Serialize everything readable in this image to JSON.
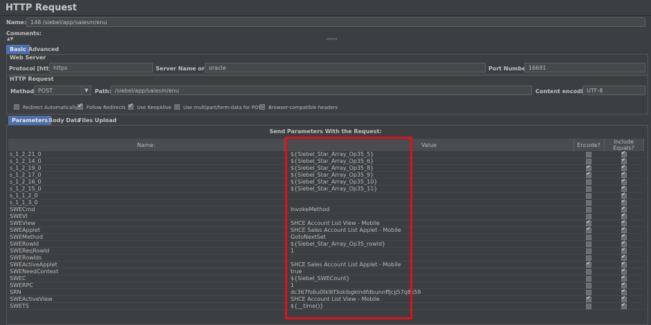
{
  "header": {
    "title": "HTTP Request",
    "name_label": "Name:",
    "name_value": "148 /siebel/app/salesm/enu",
    "comments_label": "Comments:",
    "toggle_arrows": "▲▼",
    "splitter": "ooooo"
  },
  "tabs": {
    "basic": "Basic",
    "advanced": "Advanced"
  },
  "web_server": {
    "title": "Web Server",
    "protocol_label": "Protocol [http]:",
    "protocol_value": "https",
    "server_label": "Server Name or IP:",
    "server_value": "oracle",
    "port_label": "Port Number:",
    "port_value": "16691"
  },
  "http_request": {
    "title": "HTTP Request",
    "method_label": "Method:",
    "method_value": "POST",
    "path_label": "Path:",
    "path_value": "/siebel/app/salesm/enu",
    "encoding_label": "Content encoding:",
    "encoding_value": "UTF-8",
    "options": [
      {
        "label": "Redirect Automatically",
        "checked": false
      },
      {
        "label": "Follow Redirects",
        "checked": true
      },
      {
        "label": "Use KeepAlive",
        "checked": true
      },
      {
        "label": "Use multipart/form-data for POST",
        "checked": false
      },
      {
        "label": "Browser-compatible headers",
        "checked": false
      }
    ]
  },
  "sub_tabs": {
    "parameters": "Parameters",
    "body_data": "Body Data",
    "files_upload": "Files Upload"
  },
  "params": {
    "title": "Send Parameters With the Request:",
    "headers": {
      "name": "Name:",
      "value": "Value",
      "encode": "Encode?",
      "include": "Include Equals?"
    },
    "rows": [
      {
        "name": "s_1_2_21_0",
        "value": "${Siebel_Star_Array_Op35_5}",
        "encode": false,
        "include": true
      },
      {
        "name": "s_1_2_14_0",
        "value": "${Siebel_Star_Array_Op35_6}",
        "encode": false,
        "include": true
      },
      {
        "name": "s_1_2_19_0",
        "value": "${Siebel_Star_Array_Op35_8}",
        "encode": true,
        "include": true
      },
      {
        "name": "s_1_2_17_0",
        "value": "${Siebel_Star_Array_Op35_9}",
        "encode": true,
        "include": true
      },
      {
        "name": "s_1_2_16_0",
        "value": "${Siebel_Star_Array_Op35_10}",
        "encode": false,
        "include": true
      },
      {
        "name": "s_1_2_15_0",
        "value": "${Siebel_Star_Array_Op35_11}",
        "encode": false,
        "include": true
      },
      {
        "name": "s_1_1_2_0",
        "value": "",
        "encode": false,
        "include": true
      },
      {
        "name": "s_1_1_3_0",
        "value": "",
        "encode": false,
        "include": true
      },
      {
        "name": "SWECmd",
        "value": "InvokeMethod",
        "encode": false,
        "include": true
      },
      {
        "name": "SWEVI",
        "value": "",
        "encode": false,
        "include": true
      },
      {
        "name": "SWEView",
        "value": "SHCE Account List View - Mobile",
        "encode": true,
        "include": true
      },
      {
        "name": "SWEApplet",
        "value": "SHCE Sales Account List Applet - Mobile",
        "encode": true,
        "include": true
      },
      {
        "name": "SWEMethod",
        "value": "GotoNextSet",
        "encode": false,
        "include": true
      },
      {
        "name": "SWERowId",
        "value": "${Siebel_Star_Array_Op35_rowId}",
        "encode": false,
        "include": true
      },
      {
        "name": "SWEReqRowId",
        "value": "1",
        "encode": false,
        "include": true
      },
      {
        "name": "SWERowIds",
        "value": "",
        "encode": false,
        "include": true
      },
      {
        "name": "SWEActiveApplet",
        "value": "SHCE Sales Account List Applet - Mobile",
        "encode": true,
        "include": true
      },
      {
        "name": "SWENeedContext",
        "value": "true",
        "encode": false,
        "include": true
      },
      {
        "name": "SWEC",
        "value": "${Siebel_SWECount}",
        "encode": false,
        "include": true
      },
      {
        "name": "SWERPC",
        "value": "1",
        "encode": false,
        "include": true
      },
      {
        "name": "SRN",
        "value": "dc367fs6u0tk9lf3okibgklndfdbunnffjcjj57q8s59",
        "encode": false,
        "include": true
      },
      {
        "name": "SWEActiveView",
        "value": "SHCE Account List View - Mobile",
        "encode": true,
        "include": true
      },
      {
        "name": "SWETS",
        "value": "${__time()}",
        "encode": false,
        "include": true
      }
    ]
  },
  "colors": {
    "background": "#3c3f41",
    "tab_active": "#4b6eaf",
    "highlight": "#e0101a"
  }
}
